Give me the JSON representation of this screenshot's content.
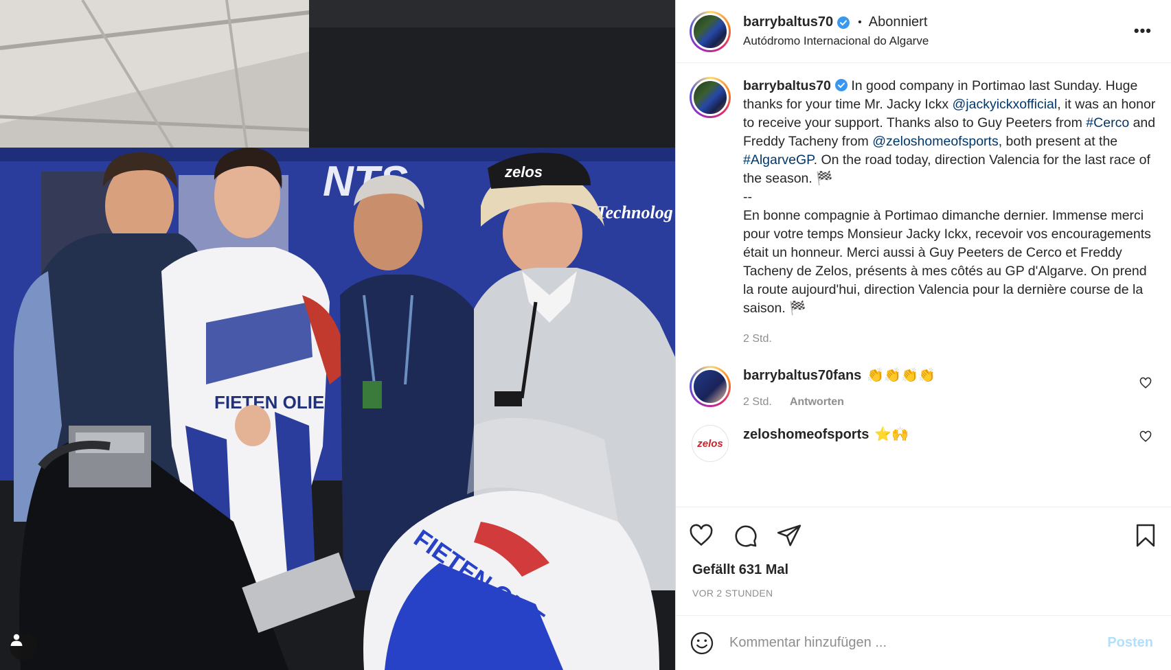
{
  "author": {
    "username": "barrybaltus70",
    "follow_status": "Abonniert",
    "location": "Autódromo Internacional do Algarve"
  },
  "caption": {
    "username": "barrybaltus70",
    "t1": " In good company in Portimao last Sunday. Huge thanks for your time Mr. Jacky Ickx ",
    "m1": "@jackyickxofficial",
    "t2": ", it was an honor to receive your support. Thanks also to Guy Peeters from ",
    "h1": "#Cerco",
    "t3": " and Freddy Tacheny from ",
    "m2": "@zeloshomeofsports",
    "t4": ", both present at the ",
    "h2": "#AlgarveGP",
    "t5": ". On the road today, direction Valencia for the last race of the season. 🏁\n--\nEn bonne compagnie à Portimao dimanche dernier. Immense merci pour votre temps Monsieur Jacky Ickx, recevoir vos encouragements était un honneur. Merci aussi à Guy Peeters de Cerco et Freddy Tacheny de Zelos, présents à mes côtés au GP d'Algarve. On prend la route aujourd'hui, direction Valencia pour la dernière course de la saison. 🏁",
    "time": "2 Std."
  },
  "comments": [
    {
      "username": "barrybaltus70fans",
      "text": "👏👏👏👏",
      "time": "2 Std.",
      "reply_label": "Antworten"
    },
    {
      "username": "zeloshomeofsports",
      "text": "⭐🙌",
      "logo_text": "zelos"
    }
  ],
  "likes_text": "Gefällt 631 Mal",
  "time_ago": "VOR 2 STUNDEN",
  "comment_input": {
    "placeholder": "Kommentar hinzufügen ...",
    "value": ""
  },
  "post_button": "Posten",
  "photo": {
    "banner_brand": "NTS",
    "banner_text": "Technolog",
    "suit_brand": "FIETEN OLIE",
    "cap_brand": "zelos"
  },
  "colors": {
    "link": "#00376b",
    "verified": "#3897f0",
    "muted": "#8e8e8e",
    "post_disabled": "#b2dffc"
  }
}
